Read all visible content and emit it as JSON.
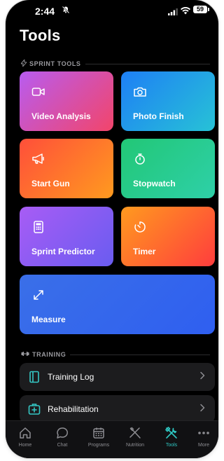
{
  "status": {
    "time": "2:44",
    "battery": "59"
  },
  "page": {
    "title": "Tools"
  },
  "sections": {
    "sprint_tools": "SPRINT TOOLS",
    "training": "TRAINING"
  },
  "tiles": [
    {
      "label": "Video Analysis",
      "icon": "video-icon",
      "gradient": [
        "#b85cf0",
        "#f2456a"
      ]
    },
    {
      "label": "Photo Finish",
      "icon": "camera-icon",
      "gradient": [
        "#1e7ff5",
        "#27c2d6"
      ]
    },
    {
      "label": "Start Gun",
      "icon": "megaphone-icon",
      "gradient": [
        "#ff4f3a",
        "#ff9a1f"
      ]
    },
    {
      "label": "Stopwatch",
      "icon": "stopwatch-icon",
      "gradient": [
        "#22c776",
        "#2ed0a8"
      ]
    },
    {
      "label": "Sprint Predictor",
      "icon": "calculator-icon",
      "gradient": [
        "#a85cf5",
        "#6a5cf0"
      ]
    },
    {
      "label": "Timer",
      "icon": "timer-icon",
      "gradient": [
        "#ff9a1f",
        "#ff3d3d"
      ]
    },
    {
      "label": "Measure",
      "icon": "resize-arrows-icon",
      "gradient": [
        "#3a6fe8",
        "#2f5ff0"
      ]
    }
  ],
  "training_items": [
    {
      "label": "Training Log",
      "icon": "notebook-icon",
      "accent": "#35c8c5"
    },
    {
      "label": "Rehabilitation",
      "icon": "first-aid-icon",
      "accent": "#35c8c5"
    }
  ],
  "tabs": [
    {
      "label": "Home",
      "icon": "home-icon"
    },
    {
      "label": "Chat",
      "icon": "chat-icon"
    },
    {
      "label": "Programs",
      "icon": "calendar-icon"
    },
    {
      "label": "Nutrition",
      "icon": "utensils-icon"
    },
    {
      "label": "Tools",
      "icon": "tools-icon",
      "active": true
    },
    {
      "label": "More",
      "icon": "more-icon"
    }
  ],
  "colors": {
    "background": "#000000",
    "card": "#1c1c1e",
    "active_tab": "#2fc7c2",
    "muted": "#8e8e93"
  }
}
